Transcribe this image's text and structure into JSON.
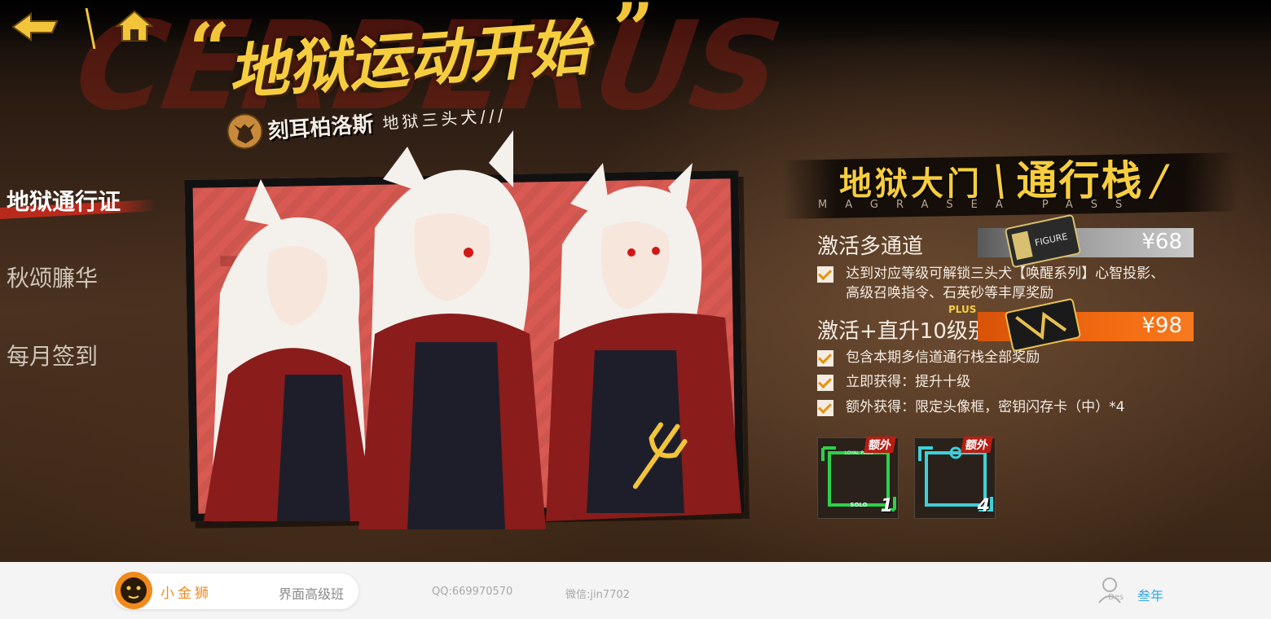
{
  "header": {
    "watermark": "CERBERUS",
    "title_open_quote": "“",
    "title": "地狱运动开始",
    "title_close_quote": "”",
    "subtitle_name": "刻耳柏洛斯",
    "subtitle_tag": "地狱三头犬///"
  },
  "nav": {
    "back_icon": "back-arrow-icon",
    "home_icon": "home-icon"
  },
  "menu": {
    "items": [
      {
        "label": "地狱通行证",
        "active": true
      },
      {
        "label": "秋颂臁华",
        "active": false
      },
      {
        "label": "每月签到",
        "active": false
      }
    ]
  },
  "pass": {
    "title_a": "地狱大门",
    "title_b": "通行栈",
    "title_en": "MAGRASEA PASS",
    "tier1": {
      "label": "激活多通道",
      "price": "¥68",
      "card_text": "FIGURE"
    },
    "tier1_benefits": [
      {
        "line1": "达到对应等级可解锁三头犬【唤醒系列】心智投影、",
        "line2": "高级召唤指令、石英砂等丰厚奖励"
      }
    ],
    "tier2": {
      "label": "激活+直升10级别!",
      "badge": "PLUS",
      "price": "¥98"
    },
    "tier2_benefits": [
      "包含本期多信道通行栈全部奖励",
      "立即获得：提升十级",
      "额外获得：限定头像框，密钥闪存卡（中）*4"
    ],
    "rewards": [
      {
        "tag": "额外",
        "count": "1",
        "top_text": "LOYAL PASS",
        "bottom_text": "SOLO",
        "color": "#2ed04a"
      },
      {
        "tag": "额外",
        "count": "4",
        "color": "#3ed0d8"
      }
    ]
  },
  "footer": {
    "brand": "小金狮",
    "course": "界面高级班",
    "qq": "QQ:669970570",
    "wechat": "微信:jin7702",
    "user_sub": "Des",
    "user_name": "叁年"
  },
  "colors": {
    "gold": "#f6cd3f",
    "red": "#c72a1c",
    "orange": "#f26a10",
    "footer_brand": "#f08a1c",
    "user_link": "#2fa6e8"
  }
}
